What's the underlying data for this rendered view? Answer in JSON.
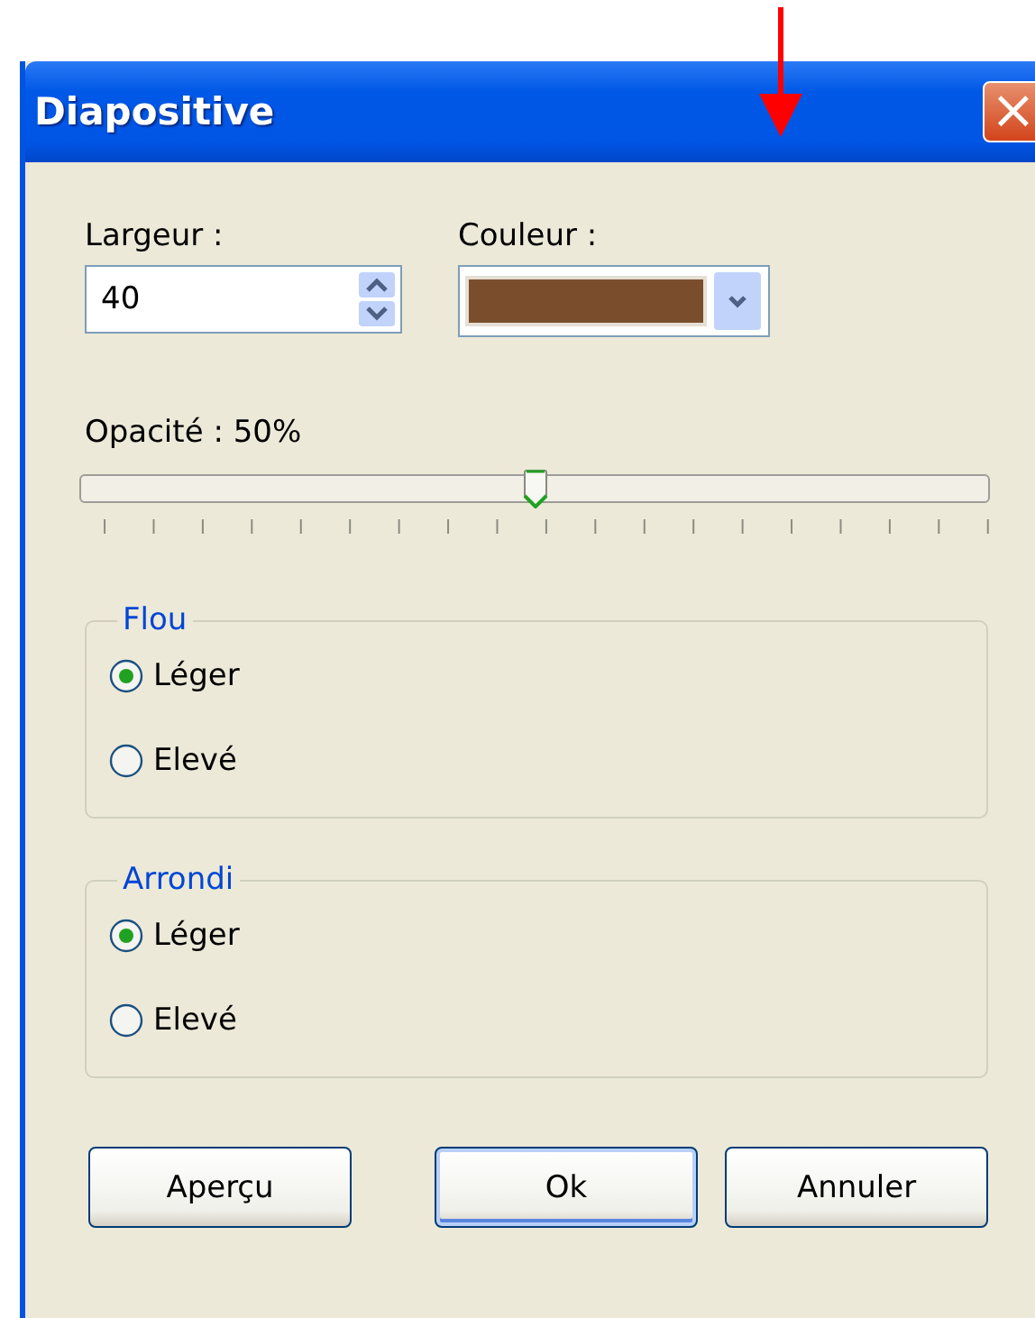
{
  "window": {
    "title": "Diapositive",
    "close": "×"
  },
  "width": {
    "label": "Largeur :",
    "value": "40"
  },
  "colour": {
    "label": "Couleur :",
    "color": "#7a4e2d"
  },
  "opacity": {
    "label": "Opacité : 50%",
    "level": 0.5
  },
  "groups": [
    {
      "title": "Flou",
      "options": [
        {
          "label": "Léger",
          "selected": true
        },
        {
          "label": "Elevé",
          "selected": false
        }
      ]
    },
    {
      "title": "Arrondi",
      "options": [
        {
          "label": "Léger",
          "selected": true
        },
        {
          "label": "Elevé",
          "selected": false
        }
      ]
    }
  ],
  "buttons": [
    {
      "label": "Aperçu",
      "default": false
    },
    {
      "label": "Ok",
      "default": true
    },
    {
      "label": "Annuler",
      "default": false
    }
  ]
}
